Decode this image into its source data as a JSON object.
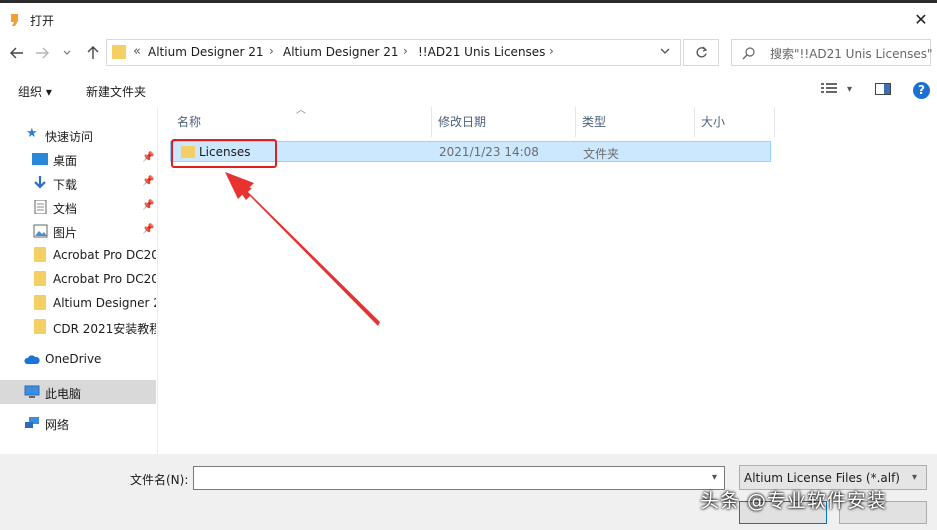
{
  "window": {
    "title": "打开",
    "close_glyph": "✕"
  },
  "address": {
    "more_glyph": "«",
    "crumbs": [
      "Altium Designer 21",
      "Altium Designer 21",
      "!!AD21 Unis Licenses"
    ],
    "search_placeholder": "搜索\"!!AD21 Unis Licenses\""
  },
  "toolbar": {
    "organize": "组织 ▾",
    "new_folder": "新建文件夹",
    "help": "?"
  },
  "nav": {
    "items": [
      {
        "label": "快速访问",
        "icon": "star-icon"
      },
      {
        "label": "桌面",
        "icon": "desktop-icon",
        "pinned": true
      },
      {
        "label": "下载",
        "icon": "download-icon",
        "pinned": true
      },
      {
        "label": "文档",
        "icon": "document-icon",
        "pinned": true
      },
      {
        "label": "图片",
        "icon": "picture-icon",
        "pinned": true
      },
      {
        "label": "Acrobat Pro DC20",
        "icon": "folder-icon"
      },
      {
        "label": "Acrobat Pro DC20",
        "icon": "folder-icon"
      },
      {
        "label": "Altium Designer 2",
        "icon": "folder-icon"
      },
      {
        "label": "CDR 2021安装教程",
        "icon": "folder-icon"
      },
      {
        "label": "OneDrive",
        "icon": "cloud-icon"
      },
      {
        "label": "此电脑",
        "icon": "computer-icon",
        "selected": true
      },
      {
        "label": "网络",
        "icon": "network-icon"
      }
    ]
  },
  "columns": {
    "name": "名称",
    "modified": "修改日期",
    "type": "类型",
    "size": "大小"
  },
  "files": [
    {
      "name": "Licenses",
      "modified": "2021/1/23 14:08",
      "type": "文件夹"
    }
  ],
  "bottom": {
    "filename_label": "文件名(N):",
    "filename_value": "",
    "filter": "Altium License Files (*.alf)",
    "watermark": "头条 @专业软件安装"
  },
  "colors": {
    "selection": "#cce8ff",
    "highlight_box": "#e02020",
    "arrow": "#e8322f",
    "folder": "#f4cf63"
  }
}
